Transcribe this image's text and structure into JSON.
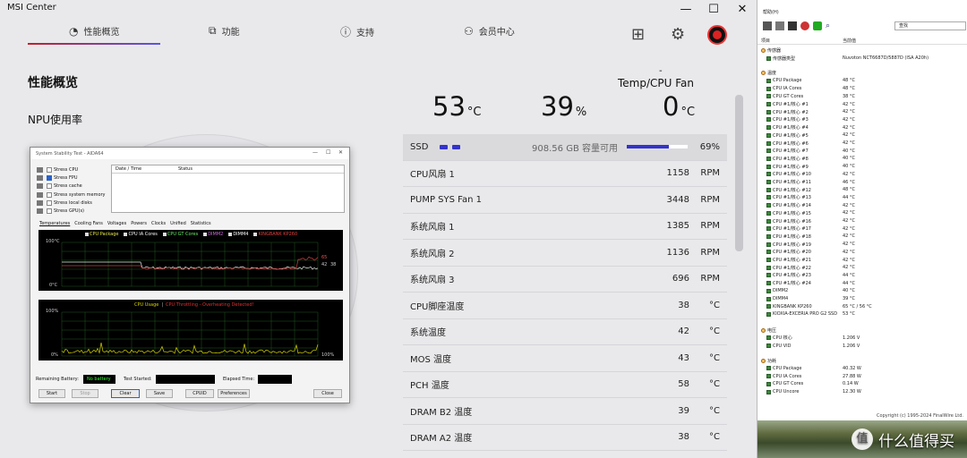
{
  "app": {
    "title": "MSI Center"
  },
  "window": {
    "minimize": "—",
    "maximize": "☐",
    "close": "✕"
  },
  "nav": [
    {
      "icon": "◔",
      "label": "性能概览"
    },
    {
      "icon": "⧉",
      "label": "功能"
    },
    {
      "icon": "ⓘ",
      "label": "支持"
    },
    {
      "icon": "⚇",
      "label": "会员中心"
    }
  ],
  "toolbar": {
    "grid_icon": "⊞",
    "gear_icon": "⚙"
  },
  "page": {
    "title": "性能概览",
    "npu_label": "NPU使用率"
  },
  "temps": {
    "header": "Temp/CPU Fan",
    "header_dash": "-",
    "cpu_temp": "53",
    "cpu_unit": "°C",
    "fan_pct": "39",
    "fan_unit": "%",
    "third": "0",
    "third_unit": "°C"
  },
  "ssd": {
    "label": "SSD",
    "capacity": "908.56 GB 容量可用",
    "pct": "69%",
    "fill": 0.69
  },
  "rows": [
    {
      "name": "CPU风扇 1",
      "value": "1158",
      "unit": "RPM"
    },
    {
      "name": "PUMP SYS Fan 1",
      "value": "3448",
      "unit": "RPM"
    },
    {
      "name": "系统风扇 1",
      "value": "1385",
      "unit": "RPM"
    },
    {
      "name": "系统风扇 2",
      "value": "1136",
      "unit": "RPM"
    },
    {
      "name": "系统风扇 3",
      "value": "696",
      "unit": "RPM"
    },
    {
      "name": "CPU脚座温度",
      "value": "38",
      "unit": "°C"
    },
    {
      "name": "系统温度",
      "value": "42",
      "unit": "°C"
    },
    {
      "name": "MOS 温度",
      "value": "43",
      "unit": "°C"
    },
    {
      "name": "PCH 温度",
      "value": "58",
      "unit": "°C"
    },
    {
      "name": "DRAM B2 温度",
      "value": "39",
      "unit": "°C"
    },
    {
      "name": "DRAM A2 温度",
      "value": "38",
      "unit": "°C"
    }
  ],
  "dialog": {
    "title": "System Stability Test - AIDA64",
    "checks": [
      {
        "label": "Stress CPU",
        "on": false
      },
      {
        "label": "Stress FPU",
        "on": true
      },
      {
        "label": "Stress cache",
        "on": false
      },
      {
        "label": "Stress system memory",
        "on": false
      },
      {
        "label": "Stress local disks",
        "on": false
      },
      {
        "label": "Stress GPU(s)",
        "on": false
      }
    ],
    "col_date": "Date / Time",
    "col_status": "Status",
    "tabs": [
      "Temperatures",
      "Cooling Fans",
      "Voltages",
      "Powers",
      "Clocks",
      "Unified",
      "Statistics"
    ],
    "legend": [
      "CPU Package",
      "CPU IA Cores",
      "CPU GT Cores",
      "DIMM2",
      "DIMM4",
      "KINGBANK KP260"
    ],
    "t_top": "100°C",
    "t_bot": "0°C",
    "t_right1": "65",
    "t_right2": "42",
    "t_right3": "38",
    "u_title": "CPU Usage",
    "u_sep": "|",
    "u_throttle": "CPU Throttling - Overheating Detected!",
    "u_top": "100%",
    "u_bot": "0%",
    "u_right": "100%",
    "remaining_battery": "Remaining Battery:",
    "battery_value": "No battery",
    "test_started": "Test Started:",
    "elapsed": "Elapsed Time:",
    "buttons": [
      "Start",
      "Stop",
      "Clear",
      "Save",
      "CPUID",
      "Preferences",
      "Close"
    ]
  },
  "aida": {
    "search_label": "查找",
    "menu": "帮助(H)",
    "col_item": "项目",
    "col_value": "当前值",
    "sensor_section": "传感器",
    "sensor_type_label": "传感器类型",
    "sensor_type_value": "Nuvoton NCT6687D/5887D (ISA A20h)",
    "temp_section": "温度",
    "temps": [
      [
        "CPU Package",
        "48 °C"
      ],
      [
        "CPU IA Cores",
        "48 °C"
      ],
      [
        "CPU GT Cores",
        "38 °C"
      ],
      [
        "CPU #1/核心 #1",
        "42 °C"
      ],
      [
        "CPU #1/核心 #2",
        "42 °C"
      ],
      [
        "CPU #1/核心 #3",
        "42 °C"
      ],
      [
        "CPU #1/核心 #4",
        "42 °C"
      ],
      [
        "CPU #1/核心 #5",
        "42 °C"
      ],
      [
        "CPU #1/核心 #6",
        "42 °C"
      ],
      [
        "CPU #1/核心 #7",
        "40 °C"
      ],
      [
        "CPU #1/核心 #8",
        "40 °C"
      ],
      [
        "CPU #1/核心 #9",
        "40 °C"
      ],
      [
        "CPU #1/核心 #10",
        "42 °C"
      ],
      [
        "CPU #1/核心 #11",
        "46 °C"
      ],
      [
        "CPU #1/核心 #12",
        "48 °C"
      ],
      [
        "CPU #1/核心 #13",
        "44 °C"
      ],
      [
        "CPU #1/核心 #14",
        "42 °C"
      ],
      [
        "CPU #1/核心 #15",
        "42 °C"
      ],
      [
        "CPU #1/核心 #16",
        "42 °C"
      ],
      [
        "CPU #1/核心 #17",
        "42 °C"
      ],
      [
        "CPU #1/核心 #18",
        "42 °C"
      ],
      [
        "CPU #1/核心 #19",
        "42 °C"
      ],
      [
        "CPU #1/核心 #20",
        "42 °C"
      ],
      [
        "CPU #1/核心 #21",
        "42 °C"
      ],
      [
        "CPU #1/核心 #22",
        "42 °C"
      ],
      [
        "CPU #1/核心 #23",
        "44 °C"
      ],
      [
        "CPU #1/核心 #24",
        "44 °C"
      ],
      [
        "DIMM2",
        "40 °C"
      ],
      [
        "DIMM4",
        "39 °C"
      ],
      [
        "KINGBANK KP260",
        "65 °C / 56 °C"
      ],
      [
        "KIOXIA-EXCERIA PRO G2 SSD",
        "53 °C"
      ]
    ],
    "volt_section": "电压",
    "volts": [
      [
        "CPU 核心",
        "1.206 V"
      ],
      [
        "CPU VID",
        "1.206 V"
      ]
    ],
    "power_section": "功耗",
    "powers": [
      [
        "CPU Package",
        "40.32 W"
      ],
      [
        "CPU IA Cores",
        "27.88 W"
      ],
      [
        "CPU GT Cores",
        "0.14 W"
      ],
      [
        "CPU Uncore",
        "12.30 W"
      ]
    ],
    "copyright": "Copyright (c) 1995-2024 FinalWire Ltd."
  },
  "watermark": {
    "logo": "值",
    "text": "什么值得买"
  }
}
